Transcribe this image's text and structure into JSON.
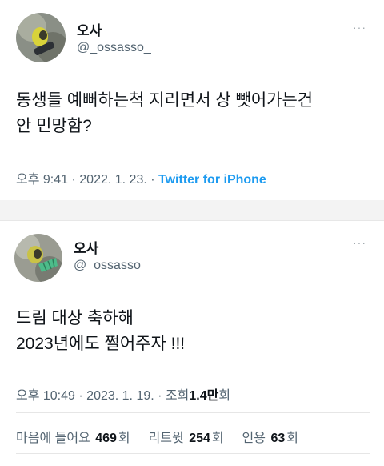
{
  "tweet1": {
    "display_name": "오사",
    "handle": "@_ossasso_",
    "more": "···",
    "text": "동생들 예뻐하는척 지리면서 상 뺏어가는건\n안 민망함?",
    "time": "오후 9:41",
    "dot1": "·",
    "date": "2022. 1. 23.",
    "dot2": "·",
    "source": "Twitter for iPhone"
  },
  "tweet2": {
    "display_name": "오사",
    "handle": "@_ossasso_",
    "more": "···",
    "text": "드림 대상 축하해\n2023년에도 쩔어주자 !!!",
    "time": "오후 10:49",
    "dot1": "·",
    "date": "2023. 1. 19.",
    "dot2": "·",
    "views_label": "조회",
    "views_value": "1.4만",
    "views_unit": "회",
    "likes_label": "마음에 들어요",
    "likes_value": "469",
    "likes_unit": "회",
    "retweets_label": "리트윗",
    "retweets_value": "254",
    "retweets_unit": "회",
    "quotes_label": "인용",
    "quotes_value": "63",
    "quotes_unit": "회"
  }
}
